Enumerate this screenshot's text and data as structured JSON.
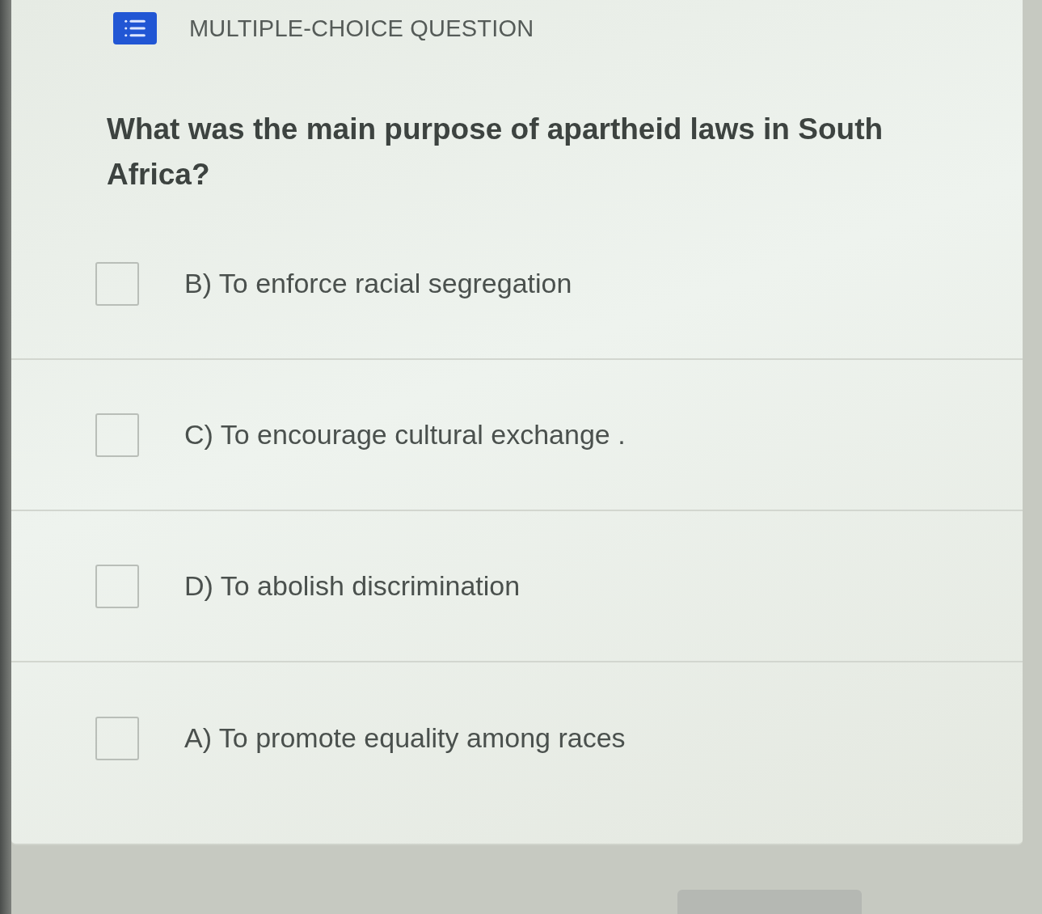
{
  "header": {
    "title": "MULTIPLE-CHOICE QUESTION"
  },
  "question": "What was the main purpose of apartheid laws in South Africa?",
  "options": [
    {
      "label": "B) To enforce racial segregation",
      "checked": false
    },
    {
      "label": "C) To encourage cultural exchange .",
      "checked": false
    },
    {
      "label": "D) To abolish discrimination",
      "checked": false
    },
    {
      "label": "A) To promote equality among races",
      "checked": false
    }
  ]
}
